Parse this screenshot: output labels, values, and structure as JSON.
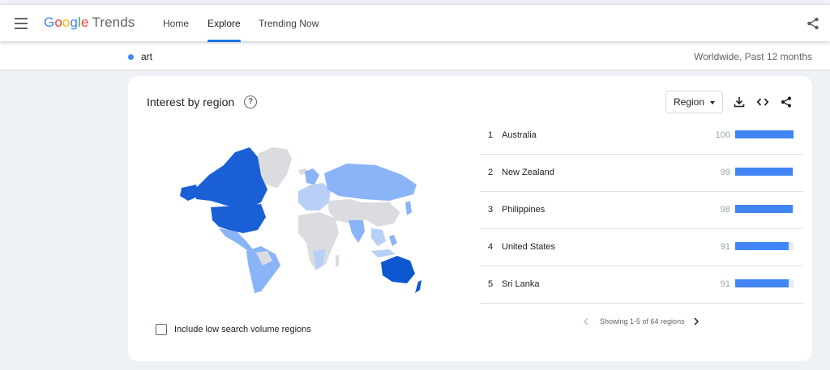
{
  "header": {
    "logo_letters": [
      "G",
      "o",
      "o",
      "g",
      "l",
      "e"
    ],
    "logo_trends": "Trends",
    "tabs": [
      {
        "label": "Home",
        "active": false
      },
      {
        "label": "Explore",
        "active": true
      },
      {
        "label": "Trending Now",
        "active": false
      }
    ],
    "icons": [
      "menu-icon",
      "share-icon"
    ]
  },
  "subbar": {
    "term": "art",
    "term_color": "#4285f4",
    "scope": "Worldwide, Past 12 months"
  },
  "card": {
    "title": "Interest by region",
    "help_glyph": "?",
    "region_select_value": "Region",
    "tools": [
      "download-icon",
      "embed-icon",
      "share-icon"
    ],
    "checkbox_label": "Include low search volume regions",
    "checkbox_checked": false,
    "rankings": [
      {
        "rank": "1",
        "name": "Australia",
        "value": "100",
        "score": 100
      },
      {
        "rank": "2",
        "name": "New Zealand",
        "value": "99",
        "score": 99
      },
      {
        "rank": "3",
        "name": "Philippines",
        "value": "98",
        "score": 98
      },
      {
        "rank": "4",
        "name": "United States",
        "value": "91",
        "score": 91
      },
      {
        "rank": "5",
        "name": "Sri Lanka",
        "value": "91",
        "score": 91
      }
    ],
    "pager_text": "Showing 1-5 of 64 regions"
  },
  "colors": {
    "accent": "#1a73e8",
    "bar": "#4285f4",
    "map_high": "#1a5fd6",
    "map_mid": "#8ab4f8",
    "map_low": "#b8d0f7",
    "map_none": "#dadce0"
  }
}
